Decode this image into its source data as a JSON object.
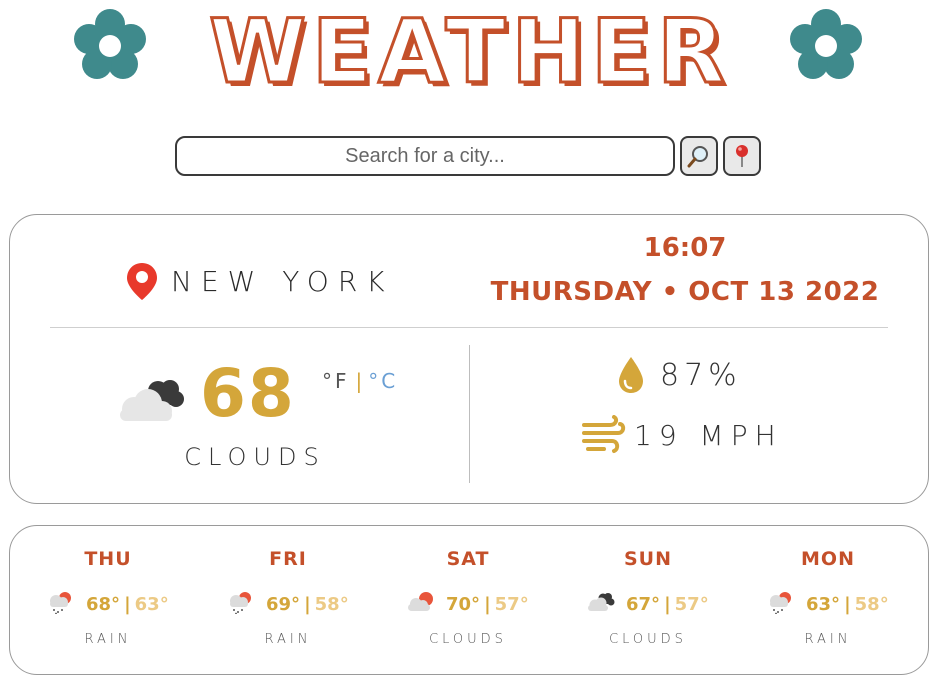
{
  "header": {
    "logo_text": "WEATHER",
    "logo_fill": "#ffffff",
    "logo_color": "#c4502a",
    "flower_color": "#3f8a8c"
  },
  "search": {
    "placeholder": "Search for a city...",
    "value": "",
    "search_icon": "magnifier-icon",
    "locate_icon": "map-pin-icon"
  },
  "current": {
    "city": "NEW YORK",
    "time": "16:07",
    "date": "THURSDAY • OCT 13 2022",
    "temperature": "68",
    "unit_f": "°F",
    "unit_separator": "|",
    "unit_c": "°C",
    "condition": "CLOUDS",
    "condition_icon": "clouds-icon",
    "humidity": "87%",
    "wind": "19 MPH"
  },
  "forecast": [
    {
      "day": "THU",
      "high": "68°",
      "low": "63°",
      "condition": "RAIN",
      "icon": "rain-icon"
    },
    {
      "day": "FRI",
      "high": "69°",
      "low": "58°",
      "condition": "RAIN",
      "icon": "rain-icon"
    },
    {
      "day": "SAT",
      "high": "70°",
      "low": "57°",
      "condition": "CLOUDS",
      "icon": "sun-cloud-icon"
    },
    {
      "day": "SUN",
      "high": "67°",
      "low": "57°",
      "condition": "CLOUDS",
      "icon": "dark-clouds-icon"
    },
    {
      "day": "MON",
      "high": "63°",
      "low": "58°",
      "condition": "RAIN",
      "icon": "rain-icon"
    }
  ],
  "colors": {
    "accent_orange": "#c4502a",
    "accent_gold": "#d4a63a",
    "accent_gold_light": "#ecca85",
    "celsius_blue": "#6a9fd4"
  }
}
